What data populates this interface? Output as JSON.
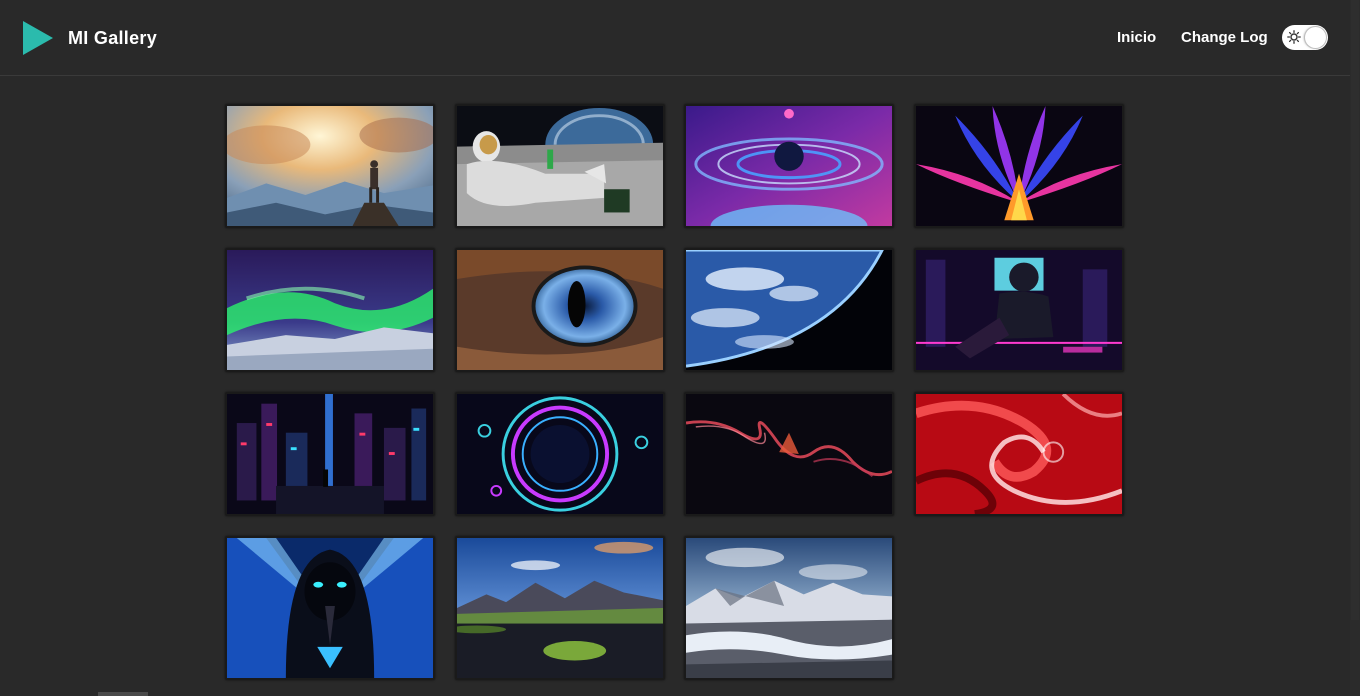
{
  "header": {
    "brand_title": "MI Gallery",
    "nav": [
      {
        "label": "Inicio"
      },
      {
        "label": "Change Log"
      }
    ],
    "theme_toggle": {
      "state": "light",
      "icon": "sun-icon"
    },
    "colors": {
      "background": "#292929",
      "logo": "#2bbbad",
      "text": "#ffffff"
    }
  },
  "gallery": {
    "images": [
      {
        "subject": "warrior-on-cliff",
        "row": 1,
        "col": 1
      },
      {
        "subject": "astronaut-on-moon",
        "row": 1,
        "col": 2
      },
      {
        "subject": "ringed-planet",
        "row": 1,
        "col": 3
      },
      {
        "subject": "neon-feathers",
        "row": 1,
        "col": 4
      },
      {
        "subject": "aurora",
        "row": 2,
        "col": 1
      },
      {
        "subject": "cat-eye",
        "row": 2,
        "col": 2
      },
      {
        "subject": "earth-from-space",
        "row": 2,
        "col": 3
      },
      {
        "subject": "neon-hero",
        "row": 2,
        "col": 4
      },
      {
        "subject": "cyberpunk-city",
        "row": 3,
        "col": 1
      },
      {
        "subject": "neon-portal",
        "row": 3,
        "col": 2
      },
      {
        "subject": "abstract-smoke",
        "row": 3,
        "col": 3
      },
      {
        "subject": "red-swirl",
        "row": 3,
        "col": 4
      },
      {
        "subject": "hooded-figure",
        "row": 4,
        "col": 1
      },
      {
        "subject": "mountain-lake",
        "row": 4,
        "col": 2
      },
      {
        "subject": "snowy-mountains",
        "row": 4,
        "col": 3
      }
    ]
  }
}
